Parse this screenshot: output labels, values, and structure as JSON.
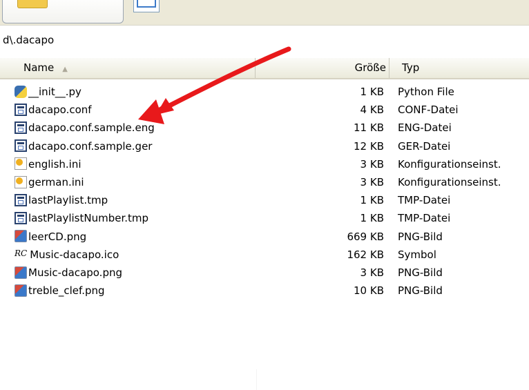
{
  "address": {
    "path": "d\\.dacapo"
  },
  "columns": {
    "name": "Name",
    "size": "Größe",
    "type": "Typ"
  },
  "files": [
    {
      "name": "__init__.py",
      "size": "1 KB",
      "type": "Python File",
      "icon": "python-file-icon"
    },
    {
      "name": "dacapo.conf",
      "size": "4 KB",
      "type": "CONF-Datei",
      "icon": "conf-file-icon"
    },
    {
      "name": "dacapo.conf.sample.eng",
      "size": "11 KB",
      "type": "ENG-Datei",
      "icon": "conf-file-icon"
    },
    {
      "name": "dacapo.conf.sample.ger",
      "size": "12 KB",
      "type": "GER-Datei",
      "icon": "conf-file-icon"
    },
    {
      "name": "english.ini",
      "size": "3 KB",
      "type": "Konfigurationseinst.",
      "icon": "ini-file-icon"
    },
    {
      "name": "german.ini",
      "size": "3 KB",
      "type": "Konfigurationseinst.",
      "icon": "ini-file-icon"
    },
    {
      "name": "lastPlaylist.tmp",
      "size": "1 KB",
      "type": "TMP-Datei",
      "icon": "tmp-file-icon"
    },
    {
      "name": "lastPlaylistNumber.tmp",
      "size": "1 KB",
      "type": "TMP-Datei",
      "icon": "tmp-file-icon"
    },
    {
      "name": "leerCD.png",
      "size": "669 KB",
      "type": "PNG-Bild",
      "icon": "png-image-icon"
    },
    {
      "name": "Music-dacapo.ico",
      "size": "162 KB",
      "type": "Symbol",
      "icon": "rc-symbol-icon",
      "icon_text": "RC"
    },
    {
      "name": "Music-dacapo.png",
      "size": "3 KB",
      "type": "PNG-Bild",
      "icon": "png-image-icon"
    },
    {
      "name": "treble_clef.png",
      "size": "10 KB",
      "type": "PNG-Bild",
      "icon": "png-image-icon"
    }
  ],
  "annotation": {
    "color": "#e8191b",
    "points_to": "dacapo.conf"
  },
  "colors": {
    "toolbar_bg": "#ece9d8",
    "header_bg": "#ebeadb",
    "arrow": "#e8191b"
  }
}
